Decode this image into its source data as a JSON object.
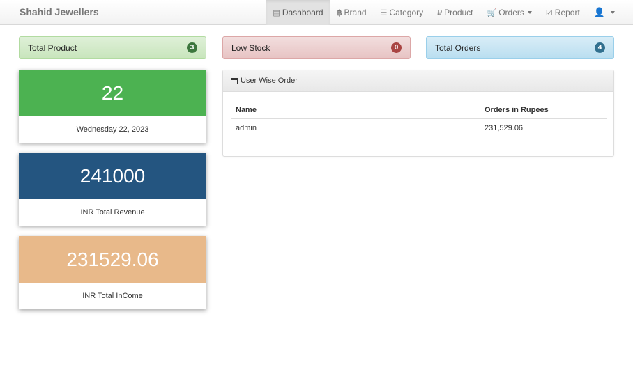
{
  "navbar": {
    "brand": "Shahid Jewellers",
    "items": [
      {
        "label": "Dashboard",
        "icon": "list-alt-icon",
        "active": true
      },
      {
        "label": "Brand",
        "icon": "btc-icon"
      },
      {
        "label": "Category",
        "icon": "th-list-icon"
      },
      {
        "label": "Product",
        "icon": "ruble-icon"
      },
      {
        "label": "Orders",
        "icon": "shopping-cart-icon",
        "dropdown": true
      },
      {
        "label": "Report",
        "icon": "check-icon"
      },
      {
        "label": "",
        "icon": "user-icon",
        "dropdown": true
      }
    ]
  },
  "alerts": {
    "total_product": {
      "label": "Total Product",
      "count": "3"
    },
    "low_stock": {
      "label": "Low Stock",
      "count": "0"
    },
    "total_orders": {
      "label": "Total Orders",
      "count": "4"
    }
  },
  "cards": {
    "date": {
      "value": "22",
      "caption": "Wednesday 22, 2023",
      "color": "#4cb251"
    },
    "revenue": {
      "value": "241000",
      "caption": "INR Total Revenue",
      "color": "#245580"
    },
    "income": {
      "value": "231529.06",
      "caption": "INR Total InCome",
      "color": "#e8b98a"
    }
  },
  "panel": {
    "title": "User Wise Order",
    "columns": [
      "Name",
      "Orders in Rupees"
    ],
    "rows": [
      [
        "admin",
        "231,529.06"
      ]
    ]
  }
}
